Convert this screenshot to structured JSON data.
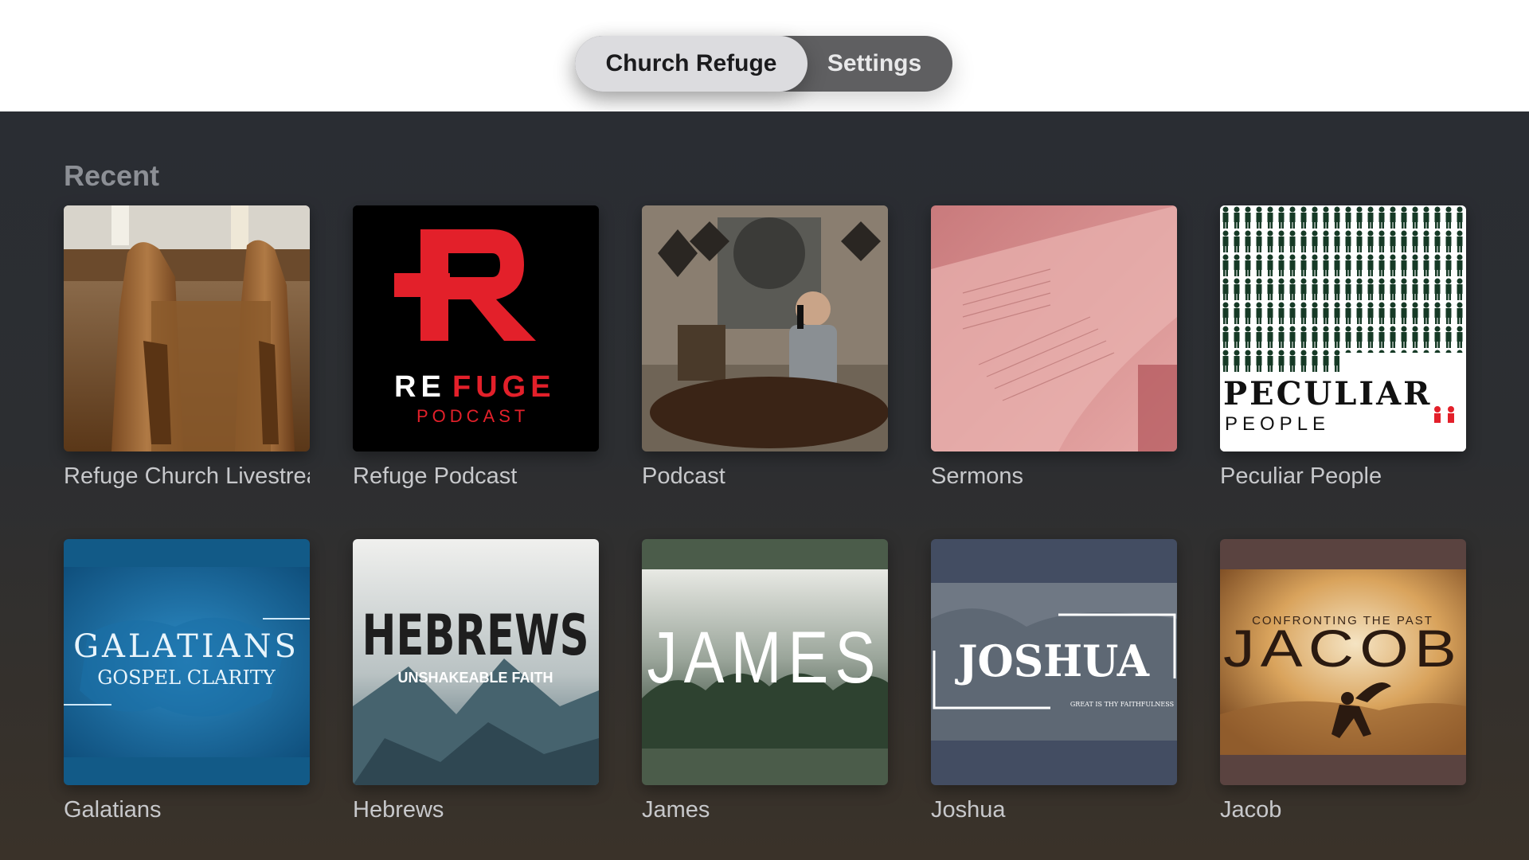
{
  "tabs": [
    {
      "label": "Church Refuge",
      "active": true
    },
    {
      "label": "Settings",
      "active": false
    }
  ],
  "recent": {
    "title": "Recent",
    "items": [
      {
        "label": "Refuge Church Livestream",
        "art": "church-pews"
      },
      {
        "label": "Refuge Podcast",
        "art": "refuge-podcast-logo",
        "art_text": {
          "word1": "RE",
          "word2": "FUGE",
          "sub": "PODCAST"
        }
      },
      {
        "label": "Podcast",
        "art": "podcast-studio"
      },
      {
        "label": "Sermons",
        "art": "open-bible"
      },
      {
        "label": "Peculiar People",
        "art": "peculiar-people-logo",
        "art_text": {
          "word1": "PECULIAR",
          "word2": "PEOPLE"
        }
      }
    ]
  },
  "series": {
    "items": [
      {
        "label": "Galatians",
        "art": "galatians-cover",
        "art_text": {
          "title": "GALATIANS",
          "sub": "GOSPEL CLARITY"
        }
      },
      {
        "label": "Hebrews",
        "art": "hebrews-cover",
        "art_text": {
          "title": "HEBREWS",
          "sub": "UNSHAKEABLE FAITH"
        }
      },
      {
        "label": "James",
        "art": "james-cover",
        "art_text": {
          "title": "JAMES"
        }
      },
      {
        "label": "Joshua",
        "art": "joshua-cover",
        "art_text": {
          "title": "JOSHUA",
          "sub": "GREAT IS THY FAITHFULNESS"
        }
      },
      {
        "label": "Jacob",
        "art": "jacob-cover",
        "art_text": {
          "title": "JACOB",
          "sub": "CONFRONTING THE PAST"
        }
      }
    ]
  },
  "colors": {
    "refuge_red": "#e3202a",
    "peculiar_green": "#163a26",
    "galatians_blue": "#1a6fa6",
    "james_green": "#4b5c4a",
    "joshua_slate": "#434d62",
    "jacob_brown": "#5a4340"
  }
}
